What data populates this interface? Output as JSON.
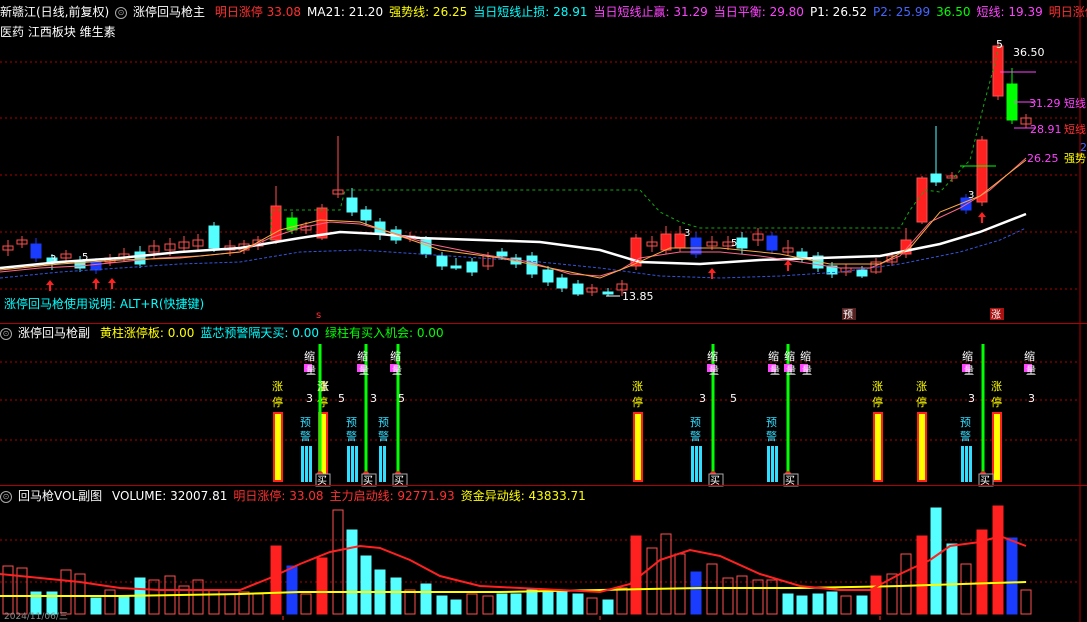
{
  "main": {
    "title": "新赣江(日线,前复权)",
    "indicator": "涨停回马枪主",
    "fields": [
      {
        "label": "明日涨停",
        "value": "33.08",
        "color": "#ff3030"
      },
      {
        "label": "MA21:",
        "value": "21.20",
        "color": "#ffffff"
      },
      {
        "label": "强势线:",
        "value": "26.25",
        "color": "#ffff00"
      },
      {
        "label": "当日短线止损:",
        "value": "28.91",
        "color": "#00ffff"
      },
      {
        "label": "当日短线止赢:",
        "value": "31.29",
        "color": "#ff44ff"
      },
      {
        "label": "当日平衡:",
        "value": "29.80",
        "color": "#ff44ff"
      },
      {
        "label": "P1:",
        "value": "26.52",
        "color": "#ffffff"
      },
      {
        "label": "P2:",
        "value": "25.99",
        "color": "#4466ff"
      },
      {
        "label": "",
        "value": "36.50",
        "color": "#00ff00"
      },
      {
        "label": "短线:",
        "value": "19.39",
        "color": "#ff44ff"
      },
      {
        "label": "明日涨停◇",
        "value": "",
        "color": "#ff3030"
      }
    ],
    "sub_title": "医药 江西板块 维生素",
    "usage_note": "涨停回马枪使用说明: ALT+R(快捷键)",
    "labels": {
      "high": "36.50",
      "low": "13.85",
      "short_win": "31.29",
      "short_win_tag": "短线",
      "short_stop": "28.91",
      "short_stop_tag": "短线",
      "strong": "26.25",
      "strong_tag": "强势",
      "right_edge": "2",
      "top_mark": "5"
    },
    "bottom_tags": {
      "s": "s",
      "yu": "预",
      "zhang": "涨"
    }
  },
  "sub1": {
    "indicator": "涨停回马枪副",
    "fields": [
      {
        "label": "黄柱涨停板:",
        "value": "0.00",
        "color": "#ffff00"
      },
      {
        "label": "蓝芯预警隔天买:",
        "value": "0.00",
        "color": "#00ffff"
      },
      {
        "label": "绿柱有买入机会:",
        "value": "0.00",
        "color": "#00ff00"
      }
    ],
    "chars": {
      "zhang": "涨",
      "ting": "停",
      "yu": "预",
      "jing": "警",
      "mai": "买",
      "suo": "缩",
      "liang": "量",
      "three": "3",
      "five": "5"
    }
  },
  "sub2": {
    "indicator": "回马枪VOL副图",
    "fields": [
      {
        "label": "VOLUME:",
        "value": "32007.81",
        "color": "#ffffff"
      },
      {
        "label": "明日涨停:",
        "value": "33.08",
        "color": "#ff3030"
      },
      {
        "label": "主力启动线:",
        "value": "92771.93",
        "color": "#ff3030"
      },
      {
        "label": "资金异动线:",
        "value": "43833.71",
        "color": "#ffff00"
      }
    ],
    "date": "2024/11/06/三"
  },
  "colors": {
    "up": "#ff2020",
    "down": "#55ffff",
    "blue": "#1a3cff",
    "green": "#00ff00",
    "yellow": "#ffff00",
    "grid": "#b00000"
  }
}
